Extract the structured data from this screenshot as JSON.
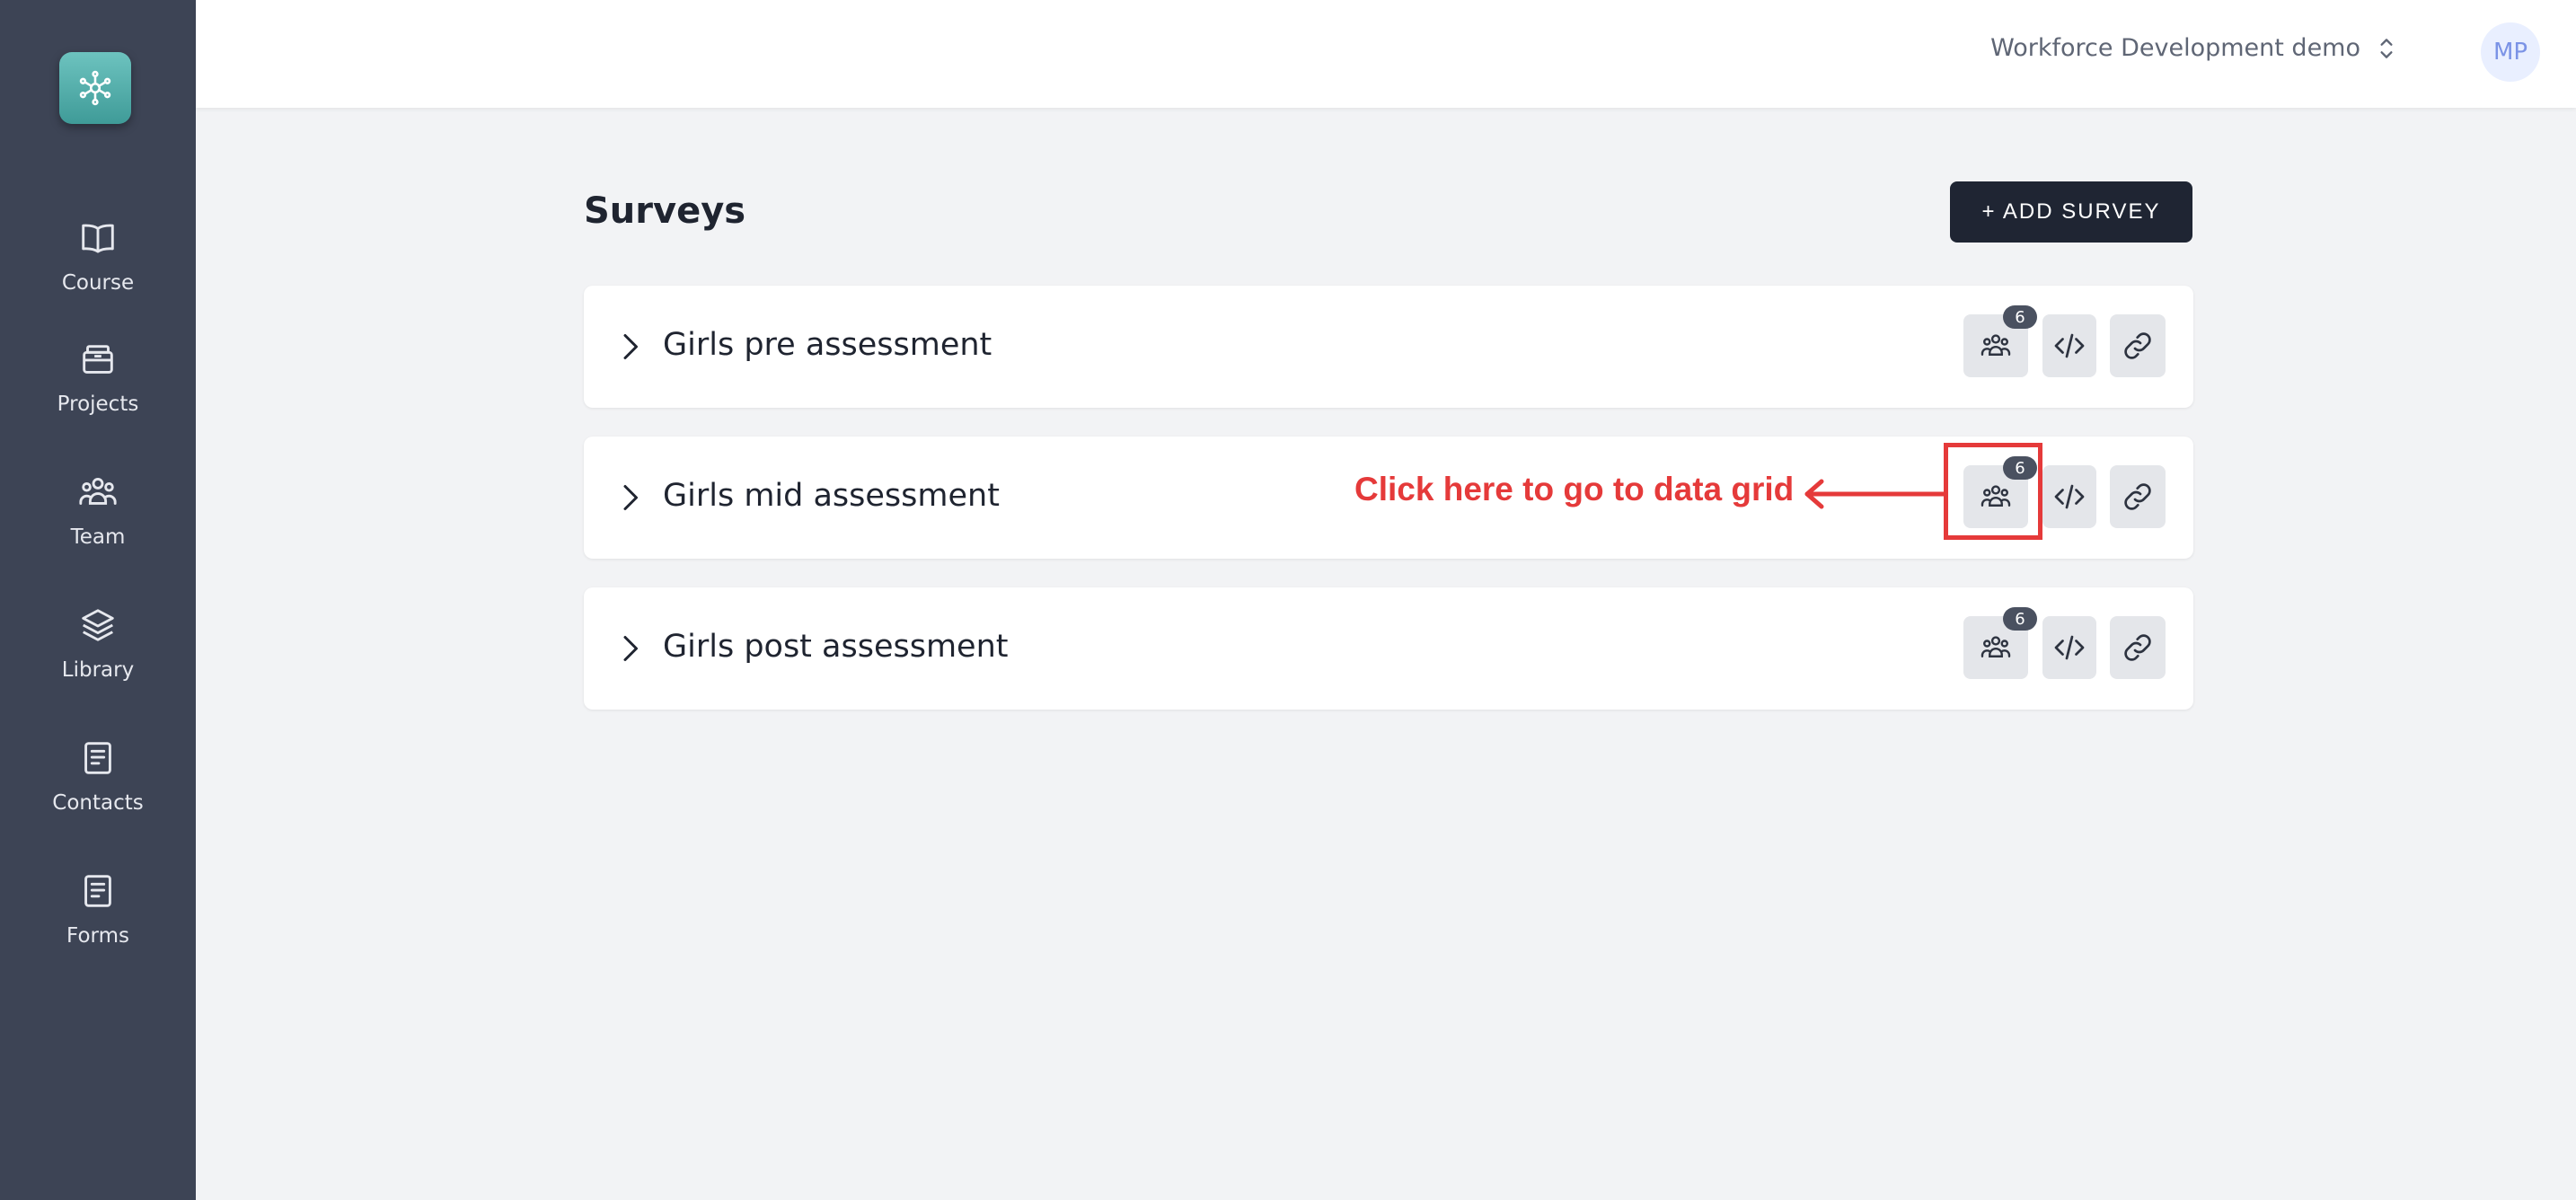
{
  "sidebar": {
    "logo": "network-logo-icon",
    "items": [
      {
        "label": "Course",
        "icon": "book-open-icon"
      },
      {
        "label": "Projects",
        "icon": "archive-box-icon"
      },
      {
        "label": "Team",
        "icon": "team-users-icon"
      },
      {
        "label": "Library",
        "icon": "layers-icon"
      },
      {
        "label": "Contacts",
        "icon": "document-list-icon"
      },
      {
        "label": "Forms",
        "icon": "document-list-icon"
      }
    ]
  },
  "header": {
    "workspace": "Workforce Development demo",
    "avatar_initials": "MP"
  },
  "main": {
    "title": "Surveys",
    "add_button": "+ ADD SURVEY",
    "surveys": [
      {
        "name": "Girls pre assessment",
        "responses": "6"
      },
      {
        "name": "Girls mid assessment",
        "responses": "6"
      },
      {
        "name": "Girls post assessment",
        "responses": "6"
      }
    ]
  },
  "annotation": {
    "text": "Click here to go to data grid",
    "color": "#e53a3a"
  },
  "colors": {
    "sidebar_bg": "#3d4455",
    "logo_accent": "#4fb0ab",
    "button_dark": "#1f2533"
  }
}
